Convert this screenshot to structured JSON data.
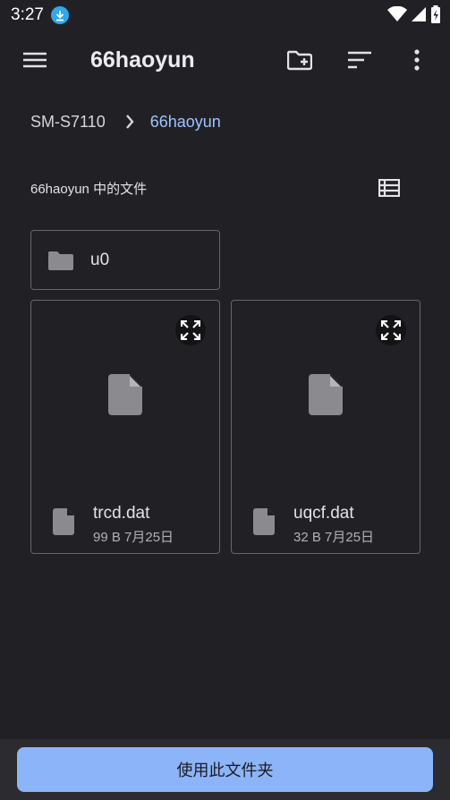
{
  "status_bar": {
    "time": "3:27",
    "icons": [
      "download-icon",
      "wifi-icon",
      "signal-icon",
      "battery-icon"
    ]
  },
  "app_bar": {
    "title": "66haoyun",
    "icons": [
      "menu-icon",
      "new-folder-icon",
      "sort-icon",
      "more-vert-icon"
    ]
  },
  "breadcrumb": {
    "root": "SM-S7110",
    "current": "66haoyun"
  },
  "section": {
    "title": "66haoyun 中的文件"
  },
  "folders": [
    {
      "name": "u0"
    }
  ],
  "files": [
    {
      "name": "trcd.dat",
      "meta": "99 B 7月25日"
    },
    {
      "name": "uqcf.dat",
      "meta": "32 B 7月25日"
    }
  ],
  "bottom": {
    "button_label": "使用此文件夹"
  },
  "colors": {
    "background": "#212125",
    "accent": "#9ec3ff",
    "button": "#8cb4f8",
    "download_badge": "#2ea8ef"
  }
}
